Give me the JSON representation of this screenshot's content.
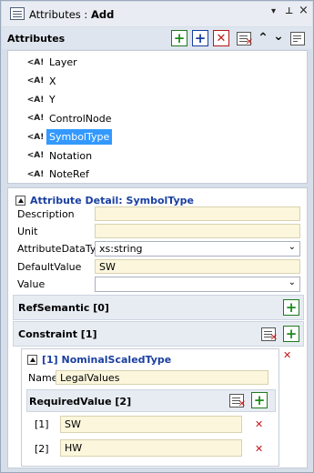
{
  "titlebar": {
    "prefix": "Attributes : ",
    "mode": "Add",
    "dropdown_glyph": "▾",
    "pin_glyph": "ᵖ",
    "close_glyph": "×"
  },
  "toolbar": {
    "label": "Attributes",
    "icons": [
      "add-icon",
      "add-blue-icon",
      "delete-icon",
      "delete-list-icon",
      "move-up-icon",
      "move-down-icon",
      "edit-icon"
    ]
  },
  "tree": {
    "icon_text": "<A!",
    "items": [
      {
        "label": "Layer",
        "selected": false
      },
      {
        "label": "X",
        "selected": false
      },
      {
        "label": "Y",
        "selected": false
      },
      {
        "label": "ControlNode",
        "selected": false
      },
      {
        "label": "SymbolType",
        "selected": true
      },
      {
        "label": "Notation",
        "selected": false
      },
      {
        "label": "NoteRef",
        "selected": false
      }
    ]
  },
  "detail": {
    "heading": "Attribute Detail: SymbolType",
    "description_label": "Description",
    "description_value": "",
    "unit_label": "Unit",
    "unit_value": "",
    "datatype_label": "AttributeDataType",
    "datatype_value": "xs:string",
    "default_label": "DefaultValue",
    "default_value": "SW",
    "value_label": "Value",
    "value_value": "",
    "refsemantic_label": "RefSemantic [0]",
    "constraint_label": "Constraint [1]"
  },
  "constraint": {
    "heading": "[1] NominalScaledType",
    "name_label": "Name",
    "name_value": "LegalValues",
    "required_label": "RequiredValue [2]",
    "values": [
      {
        "index": "[1]",
        "value": "SW"
      },
      {
        "index": "[2]",
        "value": "HW"
      }
    ]
  },
  "colors": {
    "accent_blue": "#1a3fa0",
    "selection": "#3399ff",
    "add_green": "#1e8a1e",
    "delete_red": "#c21818",
    "field_bg": "#fbf6dc"
  }
}
